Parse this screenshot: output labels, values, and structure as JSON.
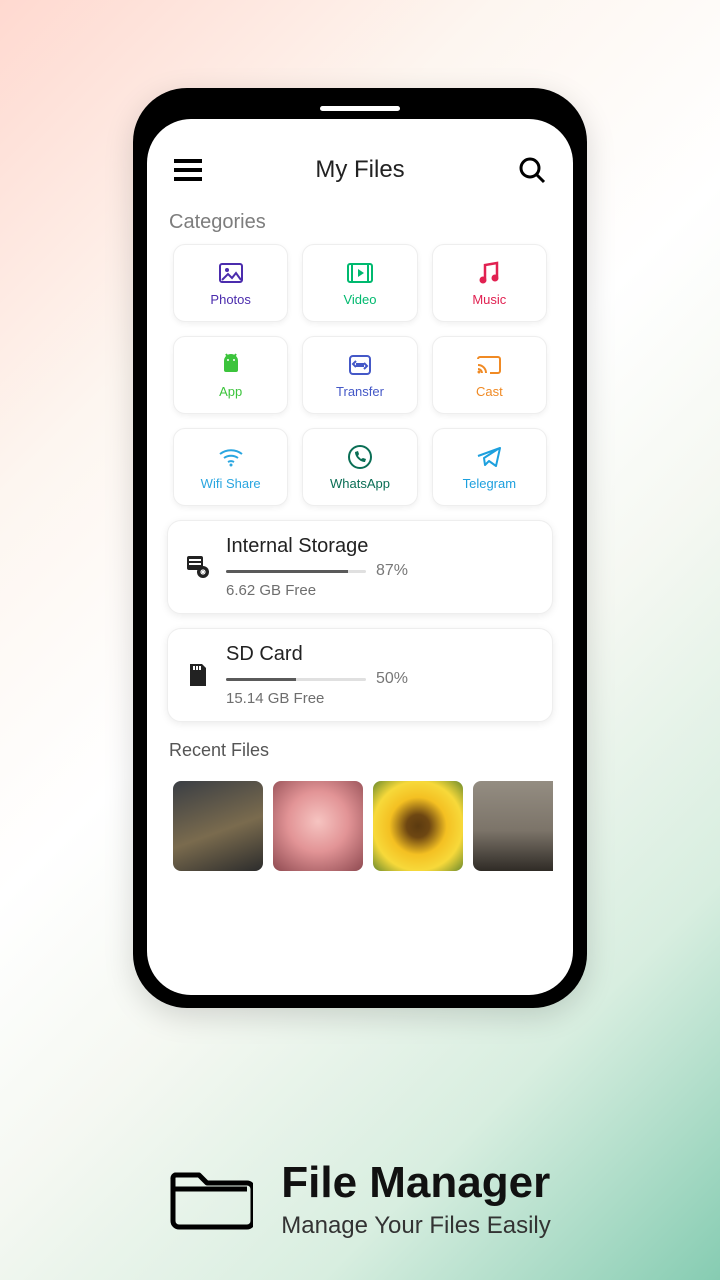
{
  "header": {
    "title": "My Files"
  },
  "sections": {
    "categories": "Categories",
    "recent": "Recent Files"
  },
  "categories": [
    {
      "label": "Photos",
      "color": "#4b2cad"
    },
    {
      "label": "Video",
      "color": "#00b96f"
    },
    {
      "label": "Music",
      "color": "#e12151"
    },
    {
      "label": "App",
      "color": "#3cc43c"
    },
    {
      "label": "Transfer",
      "color": "#4458c7"
    },
    {
      "label": "Cast",
      "color": "#f08a24"
    },
    {
      "label": "Wifi Share",
      "color": "#2aa6e0"
    },
    {
      "label": "WhatsApp",
      "color": "#0a6e55"
    },
    {
      "label": "Telegram",
      "color": "#1da0de"
    }
  ],
  "storage": [
    {
      "name": "Internal Storage",
      "percent": "87%",
      "percentNum": 87,
      "free": "6.62 GB Free"
    },
    {
      "name": "SD Card",
      "percent": "50%",
      "percentNum": 50,
      "free": "15.14 GB Free"
    }
  ],
  "promo": {
    "title": "File Manager",
    "subtitle": "Manage Your Files Easily"
  }
}
